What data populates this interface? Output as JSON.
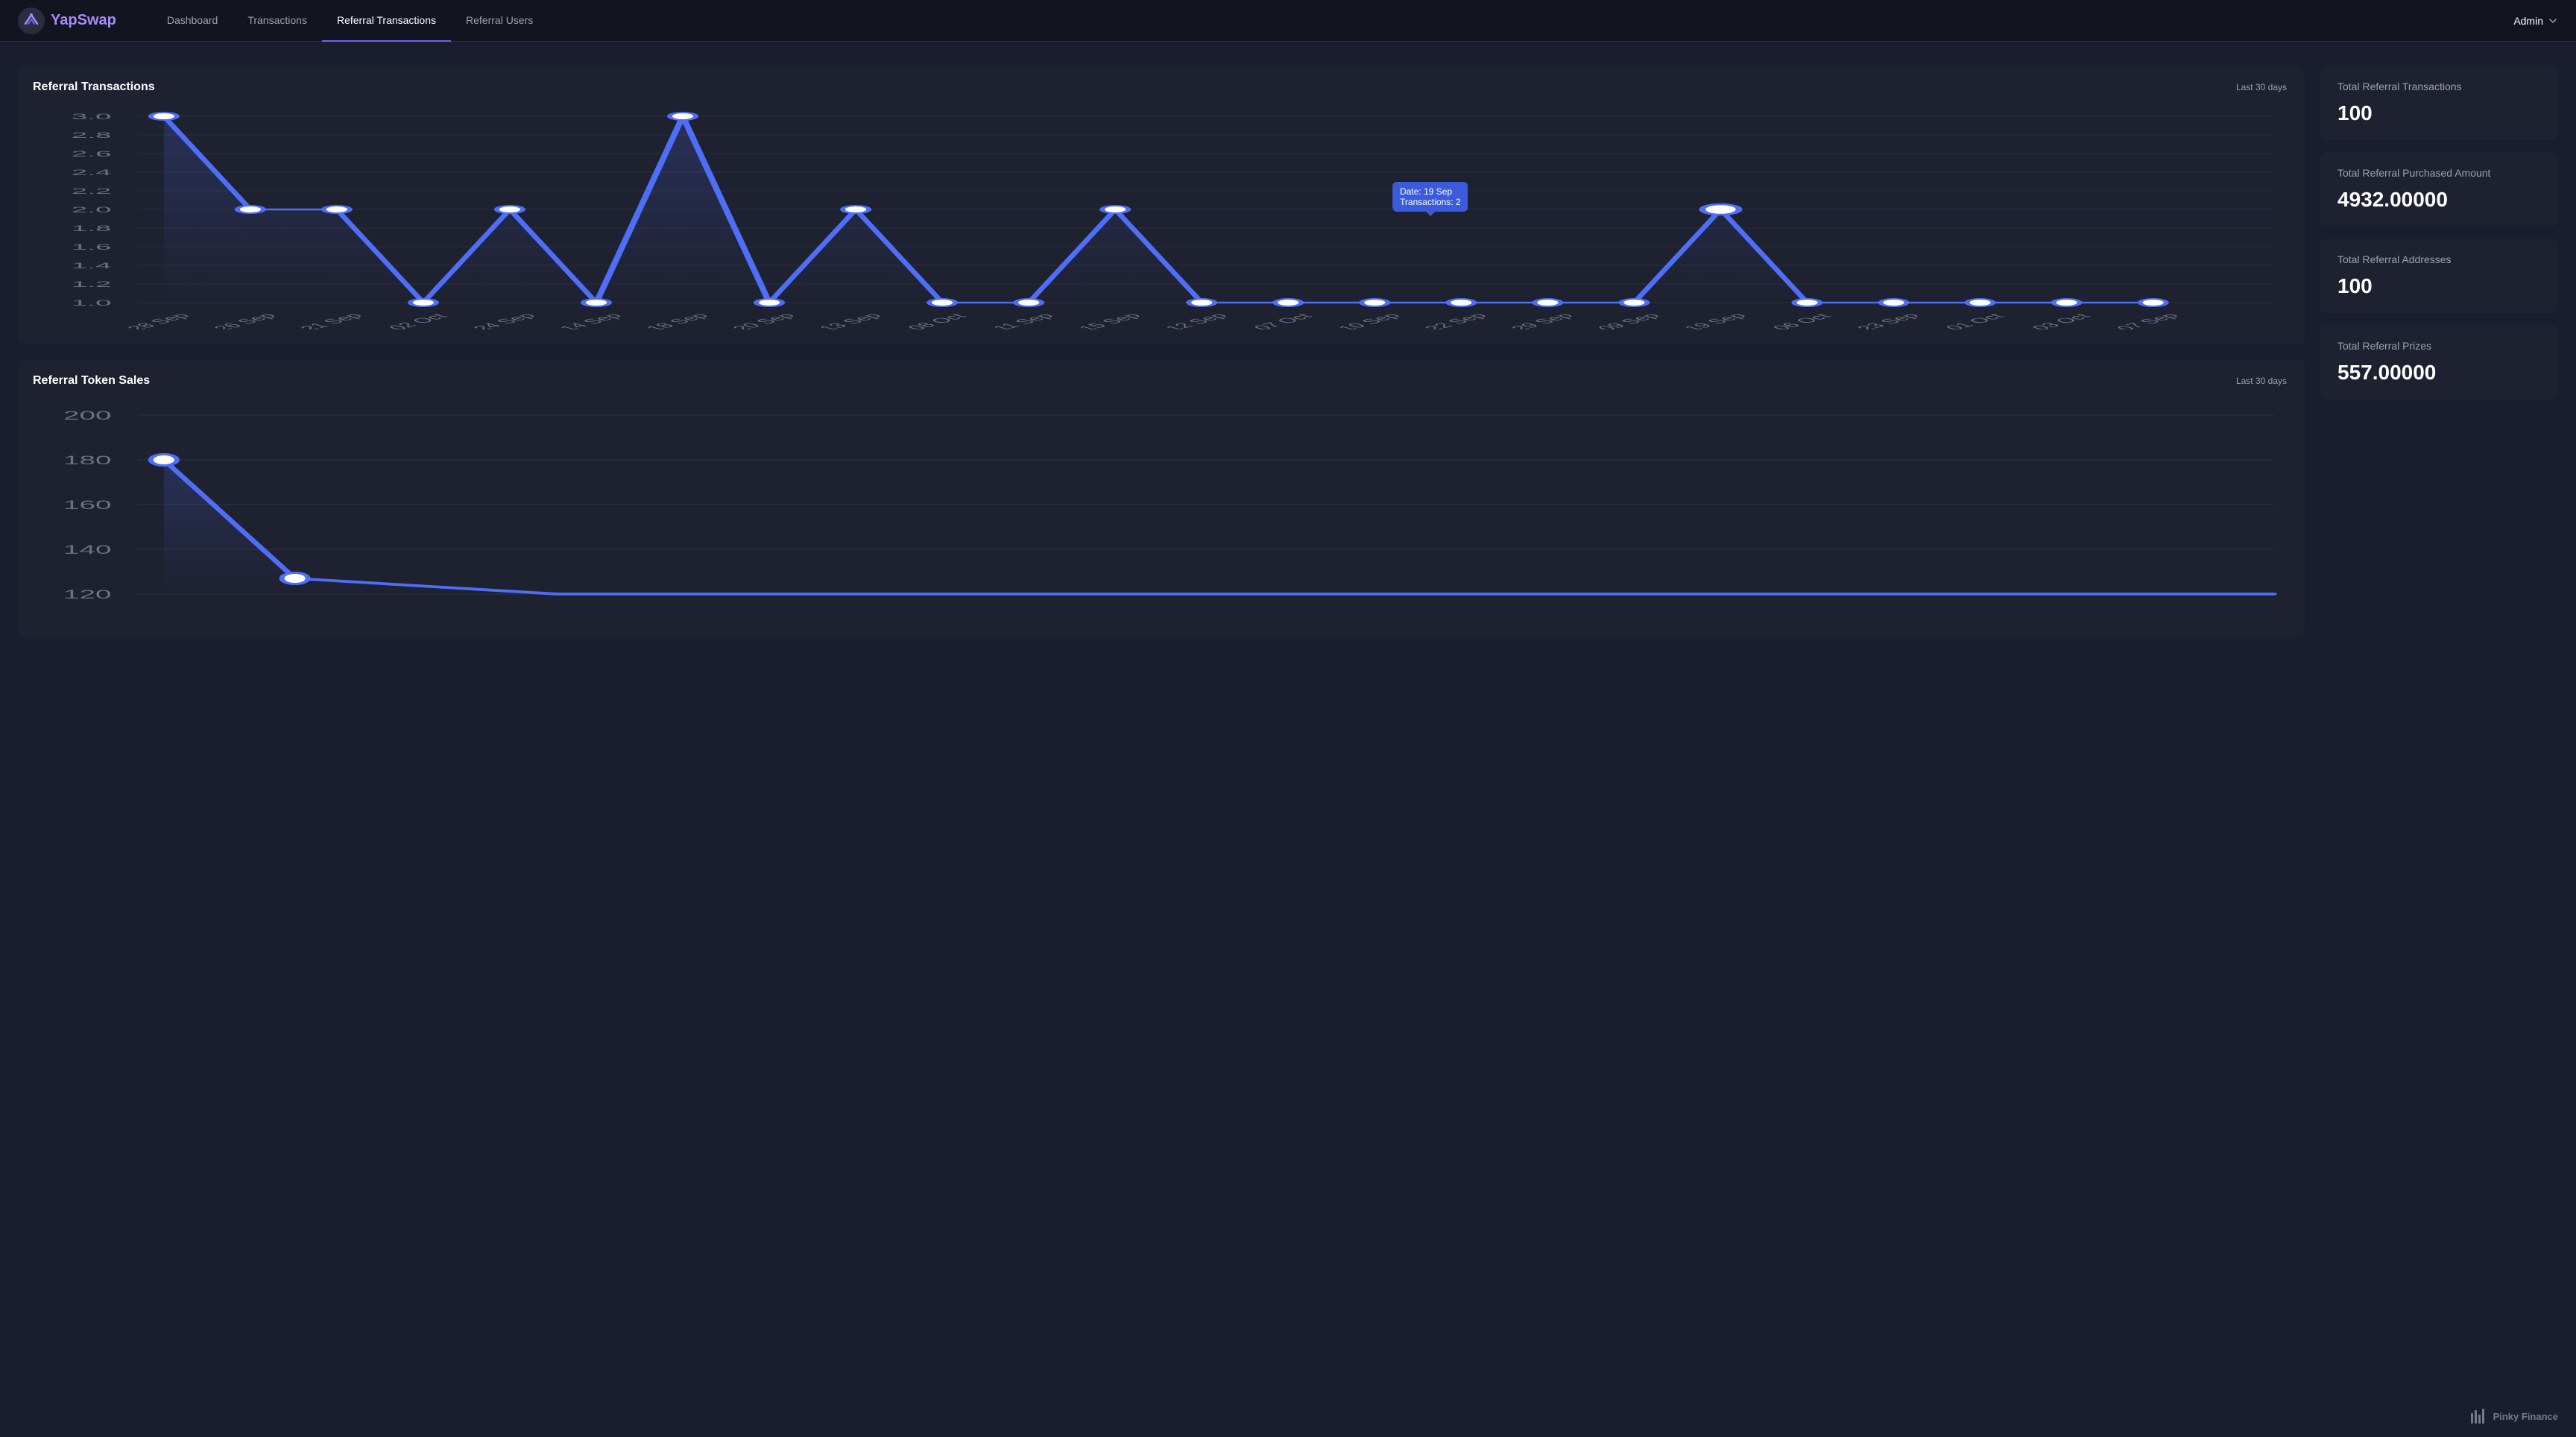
{
  "app": {
    "logo_yap": "Yap",
    "logo_swap": "Swap",
    "admin_label": "Admin"
  },
  "nav": {
    "links": [
      {
        "label": "Dashboard",
        "active": false
      },
      {
        "label": "Transactions",
        "active": false
      },
      {
        "label": "Referral Transactions",
        "active": true
      },
      {
        "label": "Referral Users",
        "active": false
      }
    ]
  },
  "stats": {
    "total_referral_transactions": {
      "title": "Total Referral Transactions",
      "value": "100"
    },
    "total_referral_purchased_amount": {
      "title": "Total Referral Purchased Amount",
      "value": "4932.00000"
    },
    "total_referral_addresses": {
      "title": "Total Referral Addresses",
      "value": "100"
    },
    "total_referral_prizes": {
      "title": "Total Referral Prizes",
      "value": "557.00000"
    }
  },
  "chart1": {
    "title": "Referral Transactions",
    "period": "Last 30 days",
    "tooltip": {
      "date_label": "Date: 19 Sep",
      "transactions_label": "Transactions: 2"
    },
    "y_labels": [
      "3.0",
      "2.8",
      "2.6",
      "2.4",
      "2.2",
      "2.0",
      "1.8",
      "1.6",
      "1.4",
      "1.2",
      "1.0"
    ],
    "x_labels": [
      "28 Sep",
      "26 Sep",
      "21 Sep",
      "02 Oct",
      "24 Sep",
      "14 Sep",
      "18 Sep",
      "20 Sep",
      "13 Sep",
      "08 Oct",
      "11 Sep",
      "15 Sep",
      "12 Sep",
      "07 Oct",
      "10 Sep",
      "22 Sep",
      "29 Sep",
      "09 Sep",
      "19 Sep",
      "06 Oct",
      "23 Sep",
      "01 Oct",
      "03 Oct",
      "07 Sep"
    ]
  },
  "chart2": {
    "title": "Referral Token Sales",
    "period": "Last 30 days",
    "y_labels": [
      "200",
      "180",
      "160",
      "140",
      "120"
    ]
  },
  "footer": {
    "brand": "Pinky Finance"
  }
}
